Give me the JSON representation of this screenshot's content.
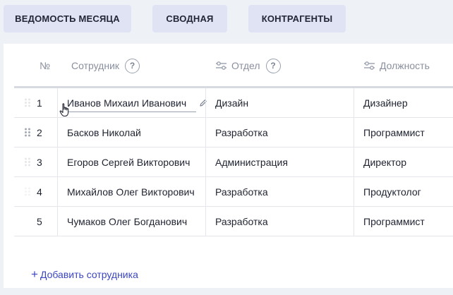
{
  "tabs": [
    {
      "label": "ВЕДОМОСТЬ МЕСЯЦА"
    },
    {
      "label": "СВОДНАЯ"
    },
    {
      "label": "КОНТРАГЕНТЫ"
    }
  ],
  "table": {
    "headers": {
      "num": "№",
      "employee": "Сотрудник",
      "department": "Отдел",
      "position": "Должность",
      "help": "?"
    },
    "rows": [
      {
        "num": "1",
        "employee": "Иванов Михаил Иванович",
        "department": "Дизайн",
        "position": "Дизайнер"
      },
      {
        "num": "2",
        "employee": "Басков Николай",
        "department": "Разработка",
        "position": "Программист"
      },
      {
        "num": "3",
        "employee": "Егоров Сергей Викторович",
        "department": "Администрация",
        "position": "Директор"
      },
      {
        "num": "4",
        "employee": "Михайлов Олег Викторович",
        "department": "Разработка",
        "position": "Продуктолог"
      },
      {
        "num": "5",
        "employee": "Чумаков Олег Богданович",
        "department": "Разработка",
        "position": "Программист"
      }
    ]
  },
  "add_employee": {
    "plus": "+",
    "label": "Добавить сотрудника"
  },
  "icons": {
    "help": "question-circle-icon",
    "filter": "sliders-icon",
    "drag": "drag-handle-icon",
    "edit": "pencil-icon",
    "cursor": "hand-pointer-icon"
  },
  "colors": {
    "tab_bg": "#dfe3f3",
    "link": "#3c46c2",
    "page_bg": "#eef1f6"
  }
}
